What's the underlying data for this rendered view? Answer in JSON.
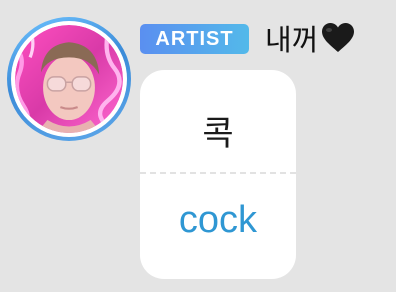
{
  "profile": {
    "role_badge": "ARTIST",
    "nickname": "내꺼",
    "heart_icon": "black-heart-icon",
    "avatar_icon": "profile-photo"
  },
  "message": {
    "original_text": "콕",
    "translated_text": "cock"
  },
  "colors": {
    "background": "#e4e4e4",
    "badge_gradient_start": "#5a8ff0",
    "badge_gradient_end": "#53b9ea",
    "translation_text": "#2f97d3",
    "avatar_ring": "#3b8bd8"
  }
}
